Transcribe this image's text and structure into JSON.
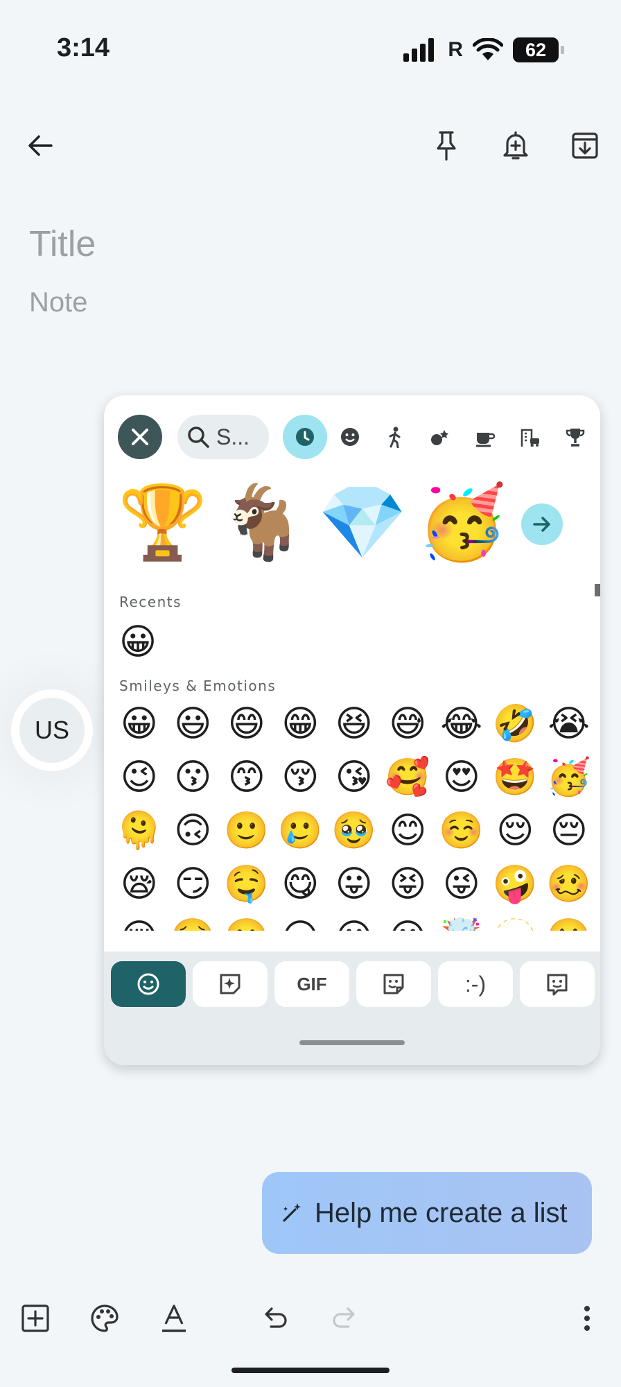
{
  "status": {
    "time": "3:14",
    "carrier_letter": "R",
    "battery": "62"
  },
  "header": {
    "back_icon": "arrow-back-icon",
    "pin_icon": "pin-icon",
    "reminder_icon": "bell-plus-icon",
    "archive_icon": "archive-icon"
  },
  "note": {
    "title_placeholder": "Title",
    "body_placeholder": "Note"
  },
  "avatar_bubble": {
    "label": "US"
  },
  "emoji_panel": {
    "search_placeholder": "S...",
    "categories": [
      "recent-icon",
      "smiley-icon",
      "person-icon",
      "activity-icon",
      "food-icon",
      "travel-icon",
      "trophy-icon"
    ],
    "featured": [
      "🏆",
      "🐐",
      "💎",
      "🥳"
    ],
    "recents_label": "Recents",
    "recents": [
      "😀"
    ],
    "smileys_label": "Smileys & Emotions",
    "smileys": [
      "😀",
      "😃",
      "😄",
      "😁",
      "😆",
      "😅",
      "😂",
      "🤣",
      "😭",
      "😉",
      "😗",
      "😙",
      "😚",
      "😘",
      "🥰",
      "😍",
      "🤩",
      "🥳",
      "🫠",
      "🙃",
      "🙂",
      "🥲",
      "🥹",
      "😊",
      "☺️",
      "😌",
      "😔",
      "😪",
      "😏",
      "🤤",
      "😋",
      "😛",
      "😝",
      "😜",
      "🤪",
      "🥴",
      "😔",
      "🥺",
      "😬",
      "😑",
      "😐",
      "😶",
      "🤯",
      "🫥",
      "🤐"
    ],
    "tabs": [
      "",
      "",
      "GIF",
      "",
      ":-)",
      ""
    ]
  },
  "assist": {
    "label": "Help me create a list"
  },
  "accent": "#1f6368"
}
